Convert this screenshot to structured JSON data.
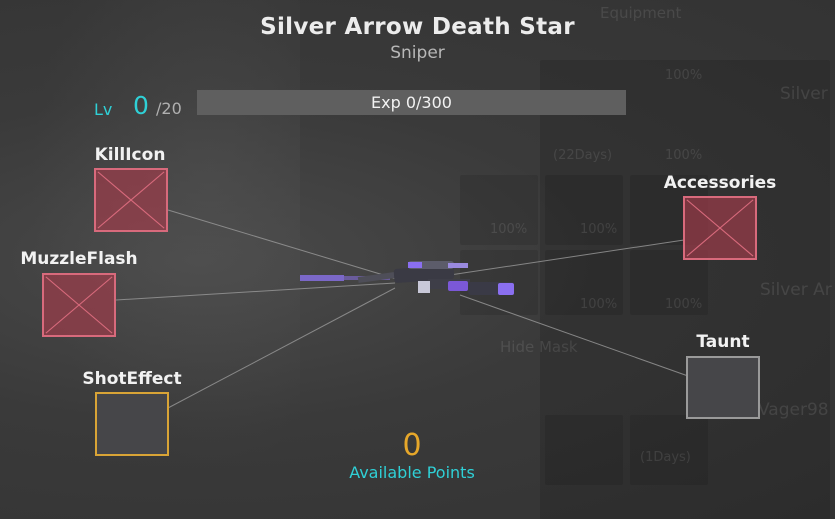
{
  "weapon": {
    "name": "Silver Arrow Death Star",
    "class": "Sniper"
  },
  "level": {
    "label": "Lv",
    "current": "0",
    "max_text": "/20"
  },
  "experience": {
    "text": "Exp 0/300",
    "current": 0,
    "max": 300
  },
  "slots": {
    "kill_icon": "KillIcon",
    "muzzle_flash": "MuzzleFlash",
    "shot_effect": "ShotEffect",
    "accessories": "Accessories",
    "taunt": "Taunt"
  },
  "points": {
    "value": "0",
    "label": "Available Points"
  },
  "background": {
    "equipment": "Equipment",
    "weapon_short": "Silver",
    "weapon_short2": "Silver Ar",
    "hide_mask": "Hide Mask",
    "player_name": "Vager98",
    "days_1": "(22Days)",
    "days_2": "(1Days)",
    "percent": "100%"
  },
  "colors": {
    "accent_cyan": "#2fd0d6",
    "points_gold": "#e6a72a",
    "slot_red": "#d86a7c",
    "slot_gold": "#d9a436"
  },
  "icons": {
    "weapon": "sniper-rifle-icon",
    "empty_slot": "cross-placeholder-icon"
  }
}
